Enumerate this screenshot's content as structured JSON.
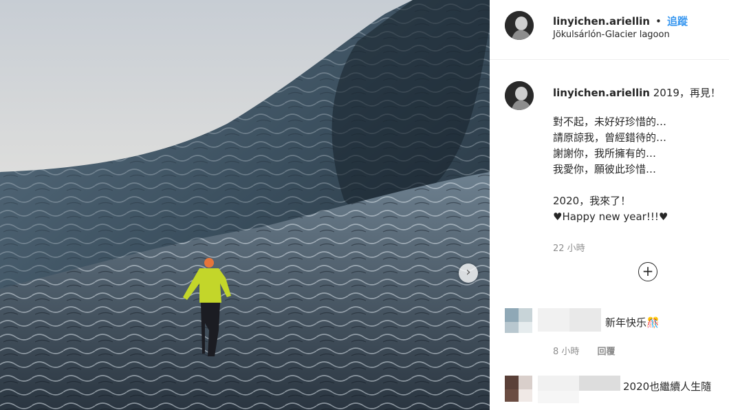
{
  "post": {
    "photo_icon": "glacier-photo",
    "next_icon": "chevron-right-icon",
    "next_symbol": "›"
  },
  "header": {
    "username": "linyichen.ariellin",
    "separator": "•",
    "follow_label": "追蹤",
    "location": "Jökulsárlón-Glacier lagoon"
  },
  "caption": {
    "username": "linyichen.ariellin",
    "first_line": "2019，再見！",
    "body": "對不起，未好好珍惜的…\n請原諒我，曾經錯待的…\n謝謝你，我所擁有的…\n我愛你，願彼此珍惜…\n\n2020，我來了！\n♥Happy new year!!!♥",
    "time": "22 小時",
    "load_more_symbol": "+"
  },
  "comments": [
    {
      "text": "新年快乐🎊",
      "time": "8 小時",
      "reply_label": "回覆"
    },
    {
      "text": "2020也繼續人生隨"
    }
  ],
  "colors": {
    "follow": "#3897f0",
    "muted": "#8e8e8e",
    "text": "#262626"
  }
}
